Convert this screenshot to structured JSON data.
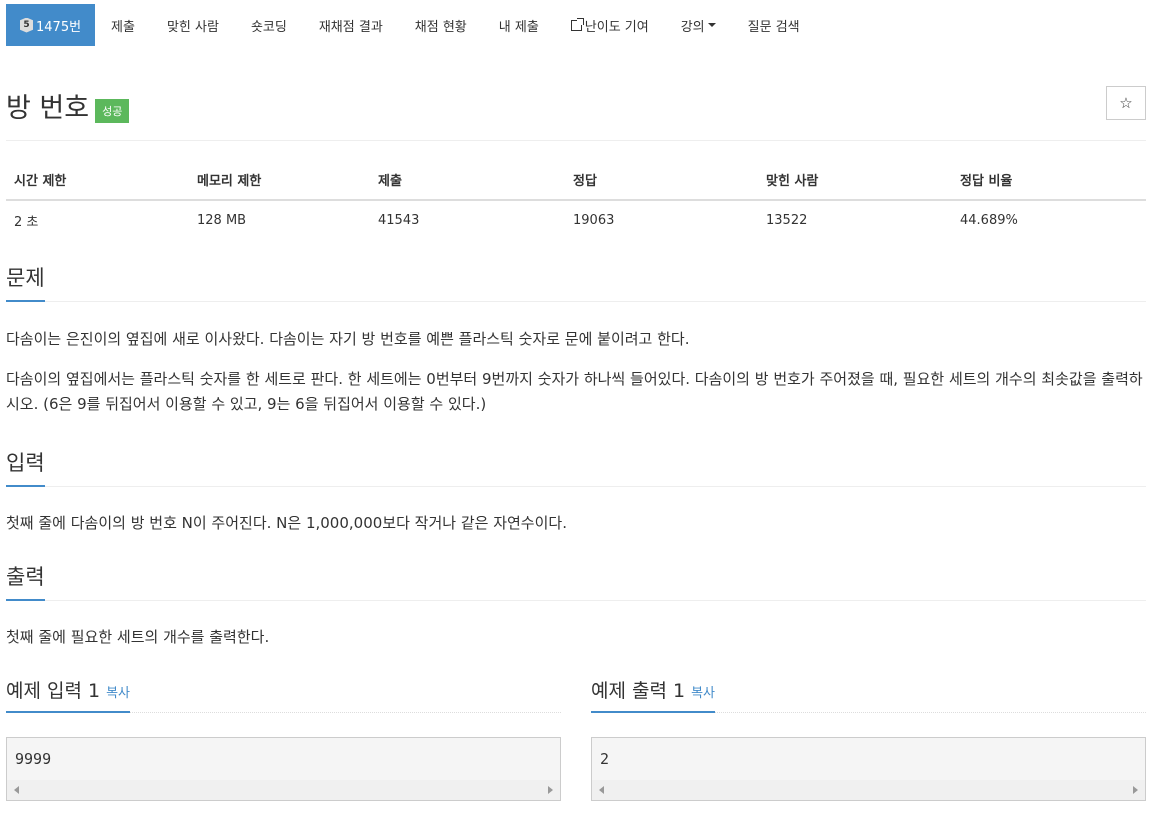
{
  "nav": {
    "problem_tier": "5",
    "problem_label": "1475번",
    "submit": "제출",
    "solved_users": "맞힌 사람",
    "short_coding": "숏코딩",
    "rejudge": "재채점 결과",
    "status": "채점 현황",
    "my_submit": "내 제출",
    "difficulty": "난이도 기여",
    "lecture": "강의",
    "qna": "질문 검색"
  },
  "problem": {
    "title": "방 번호",
    "result_badge": "성공",
    "star": "☆"
  },
  "info_table": {
    "headers": [
      "시간 제한",
      "메모리 제한",
      "제출",
      "정답",
      "맞힌 사람",
      "정답 비율"
    ],
    "values": [
      "2 초",
      "128 MB",
      "41543",
      "19063",
      "13522",
      "44.689%"
    ]
  },
  "sections": {
    "description_title": "문제",
    "description_p1": "다솜이는 은진이의 옆집에 새로 이사왔다. 다솜이는 자기 방 번호를 예쁜 플라스틱 숫자로 문에 붙이려고 한다.",
    "description_p2": "다솜이의 옆집에서는 플라스틱 숫자를 한 세트로 판다. 한 세트에는 0번부터 9번까지 숫자가 하나씩 들어있다. 다솜이의 방 번호가 주어졌을 때, 필요한 세트의 개수의 최솟값을 출력하시오. (6은 9를 뒤집어서 이용할 수 있고, 9는 6을 뒤집어서 이용할 수 있다.)",
    "input_title": "입력",
    "input_text": "첫째 줄에 다솜이의 방 번호 N이 주어진다. N은 1,000,000보다 작거나 같은 자연수이다.",
    "output_title": "출력",
    "output_text": "첫째 줄에 필요한 세트의 개수를 출력한다."
  },
  "samples": {
    "input_title": "예제 입력 1",
    "output_title": "예제 출력 1",
    "copy": "복사",
    "input_value": "9999",
    "output_value": "2"
  }
}
